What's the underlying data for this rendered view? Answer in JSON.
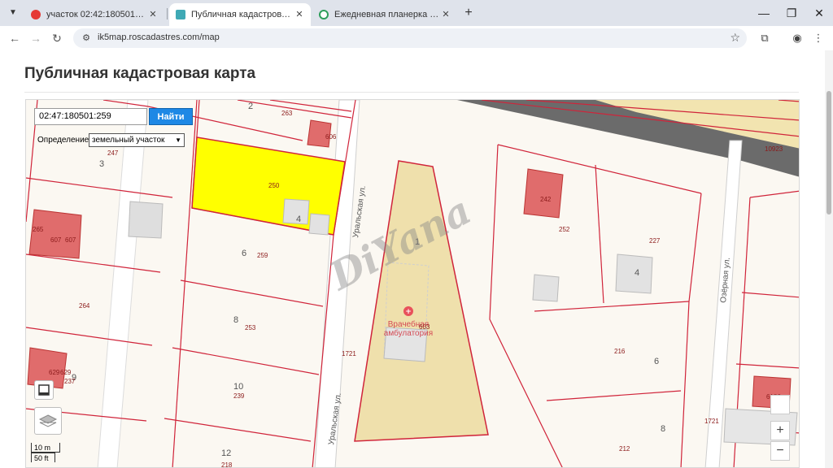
{
  "browser": {
    "tabs": [
      {
        "title": "участок 02:42:180501:259 — Ян",
        "active": false,
        "favicon_color": "#e53935"
      },
      {
        "title": "Публичная кадастровая карта",
        "active": true,
        "favicon_color": "#3fa9b5"
      },
      {
        "title": "Ежедневная планерка с опера",
        "active": false,
        "favicon_color": "#2e9e5b"
      }
    ],
    "url": "ik5map.roscadastres.com/map"
  },
  "page": {
    "title": "Публичная кадастровая карта"
  },
  "map": {
    "search_value": "02:47:180501:259",
    "find_button": "Найти",
    "definition_label": "Определение:",
    "definition_value": "земельный участок",
    "scale_metric": "10 m",
    "scale_imperial": "50 ft",
    "zoom_in": "+",
    "zoom_out": "−",
    "watermark": "DiYana",
    "poi_name": "Врачебная амбулатория",
    "streets": [
      "Уральская ул.",
      "Уральская ул.",
      "Озёрная ул."
    ],
    "labels": {
      "block_numbers": [
        "2",
        "3",
        "4",
        "6",
        "8",
        "10",
        "12",
        "4",
        "6",
        "8",
        "1",
        "9"
      ],
      "parcel_numbers": [
        "263",
        "606",
        "247",
        "250",
        "265",
        "607",
        "607",
        "259",
        "264",
        "253",
        "629",
        "629",
        "237",
        "239",
        "218",
        "1721",
        "603",
        "252",
        "227",
        "216",
        "212",
        "1721",
        "6186",
        "10923",
        "242"
      ]
    }
  }
}
